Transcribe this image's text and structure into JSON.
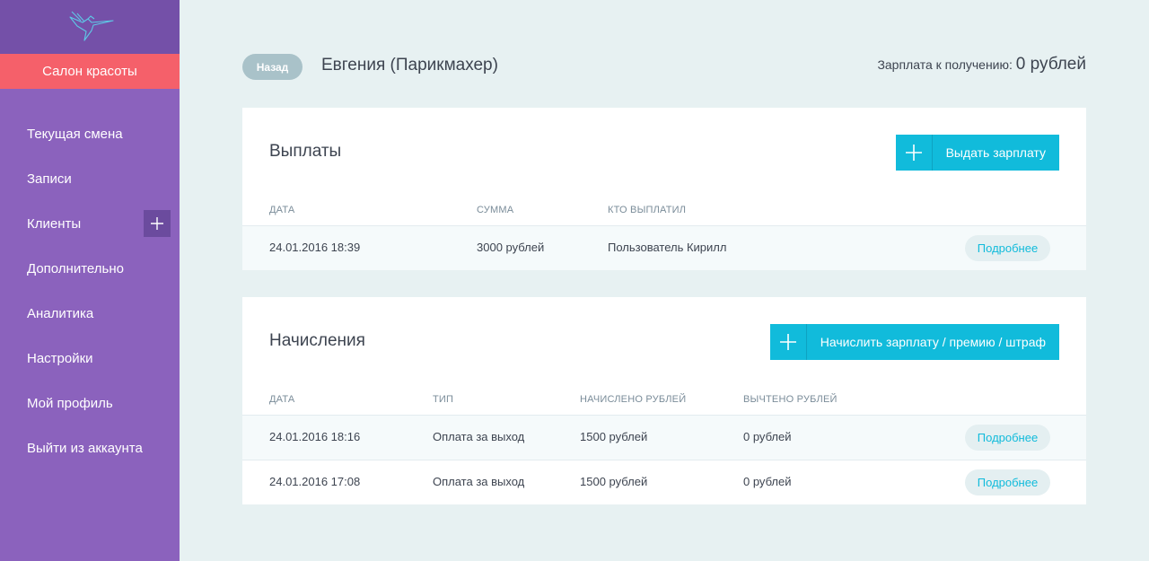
{
  "sidebar": {
    "salon_name": "Салон красоты",
    "items": [
      {
        "label": "Текущая смена"
      },
      {
        "label": "Записи"
      },
      {
        "label": "Клиенты"
      },
      {
        "label": "Дополнительно"
      },
      {
        "label": "Аналитика"
      },
      {
        "label": "Настройки"
      },
      {
        "label": "Мой профиль"
      },
      {
        "label": "Выйти из аккаунта"
      }
    ]
  },
  "header": {
    "back_label": "Назад",
    "employee": "Евгения (Парикмахер)",
    "salary_label": "Зарплата к получению:",
    "salary_value": "0 рублей"
  },
  "payouts": {
    "title": "Выплаты",
    "action_label": "Выдать зарплату",
    "columns": [
      "ДАТА",
      "СУММА",
      "КТО ВЫПЛАТИЛ"
    ],
    "rows": [
      {
        "date": "24.01.2016 18:39",
        "amount": "3000 рублей",
        "paid_by": "Пользователь Кирилл",
        "more": "Подробнее"
      }
    ]
  },
  "accruals": {
    "title": "Начисления",
    "action_label": "Начислить зарплату / премию / штраф",
    "columns": [
      "ДАТА",
      "ТИП",
      "НАЧИСЛЕНО РУБЛЕЙ",
      "ВЫЧТЕНО РУБЛЕЙ"
    ],
    "rows": [
      {
        "date": "24.01.2016 18:16",
        "type": "Оплата за выход",
        "accrued": "1500 рублей",
        "deducted": "0 рублей",
        "more": "Подробнее"
      },
      {
        "date": "24.01.2016 17:08",
        "type": "Оплата за выход",
        "accrued": "1500 рублей",
        "deducted": "0 рублей",
        "more": "Подробнее"
      }
    ]
  },
  "colors": {
    "sidebar": "#8b62bd",
    "sidebar_top": "#7450a8",
    "salon_accent": "#f5606a",
    "primary": "#11bbdb",
    "background": "#e7f1f2"
  },
  "icons": [
    "hummingbird-logo",
    "plus-icon"
  ]
}
